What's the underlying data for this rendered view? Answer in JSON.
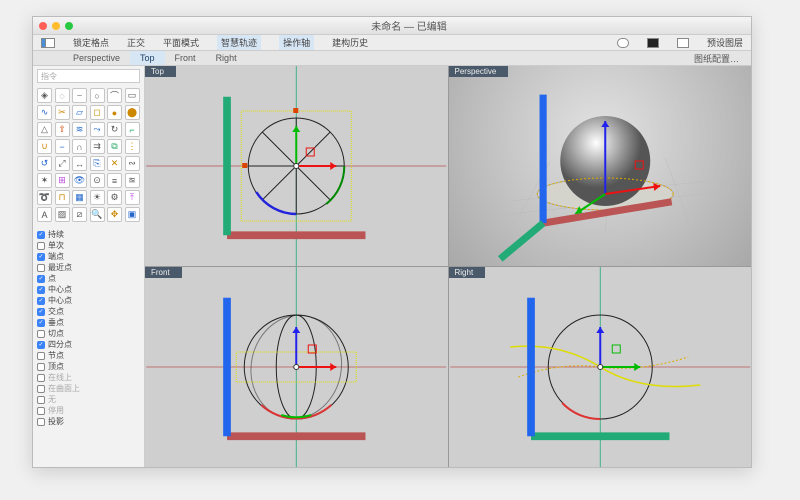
{
  "title": "未命名 — 已编辑",
  "menu": {
    "lock": "锁定格点",
    "ortho": "正交",
    "cplane": "平面模式",
    "smart": "智慧轨迹",
    "gumball": "操作轴",
    "history": "建构历史",
    "preset": "预设图层"
  },
  "viewtabs": {
    "perspective": "Perspective",
    "top": "Top",
    "front": "Front",
    "right": "Right",
    "config": "图纸配置…"
  },
  "cmd_placeholder": "指令",
  "viewport_labels": {
    "top": "Top",
    "persp": "Perspective",
    "front": "Front",
    "right": "Right"
  },
  "snaps": [
    {
      "label": "持续",
      "on": true
    },
    {
      "label": "单次",
      "on": false
    },
    {
      "label": "端点",
      "on": true
    },
    {
      "label": "最近点",
      "on": false
    },
    {
      "label": "点",
      "on": true
    },
    {
      "label": "中心点",
      "on": true
    },
    {
      "label": "中心点",
      "on": true
    },
    {
      "label": "交点",
      "on": true
    },
    {
      "label": "垂点",
      "on": true
    },
    {
      "label": "切点",
      "on": false
    },
    {
      "label": "四分点",
      "on": true
    },
    {
      "label": "节点",
      "on": false
    },
    {
      "label": "顶点",
      "on": false
    },
    {
      "label": "在线上",
      "on": false,
      "dim": true
    },
    {
      "label": "在曲面上",
      "on": false,
      "dim": true
    },
    {
      "label": "无",
      "on": false,
      "dim": true
    },
    {
      "label": "停用",
      "on": false,
      "dim": true
    },
    {
      "label": "投影",
      "on": false
    }
  ],
  "tool_names": [
    "pointer",
    "lasso",
    "polyline",
    "circle",
    "arc",
    "rectangle",
    "curve",
    "trim",
    "surface-plane",
    "box",
    "sphere",
    "cylinder",
    "cone",
    "extrude",
    "loft",
    "sweep",
    "revolve",
    "fillet",
    "boolean-union",
    "boolean-diff",
    "boolean-intersect",
    "offset",
    "mirror",
    "array",
    "rotate",
    "scale",
    "move",
    "copy",
    "split",
    "join",
    "explode",
    "group",
    "hide",
    "show",
    "layer",
    "match",
    "blend",
    "cap",
    "mesh",
    "render",
    "analyze",
    "dim",
    "text",
    "hatch",
    "section",
    "zoom",
    "pan",
    "view",
    "shade",
    "wire"
  ],
  "tool_colors": [
    "#555",
    "#555",
    "#555",
    "#555",
    "#555",
    "#555",
    "#26c",
    "#c80",
    "#26c",
    "#c80",
    "#c80",
    "#c80",
    "#555",
    "#c40",
    "#26c",
    "#26c",
    "#555",
    "#2a6",
    "#c80",
    "#26c",
    "#555",
    "#555",
    "#2a6",
    "#c80",
    "#26c",
    "#555",
    "#555",
    "#26c",
    "#c80",
    "#555",
    "#555",
    "#b4d",
    "#26c",
    "#555",
    "#555",
    "#555",
    "#2a6",
    "#c80",
    "#26c",
    "#555",
    "#555",
    "#b4d",
    "#555",
    "#555",
    "#555",
    "#555",
    "#c80",
    "#26c",
    "#2a6",
    "#555"
  ]
}
